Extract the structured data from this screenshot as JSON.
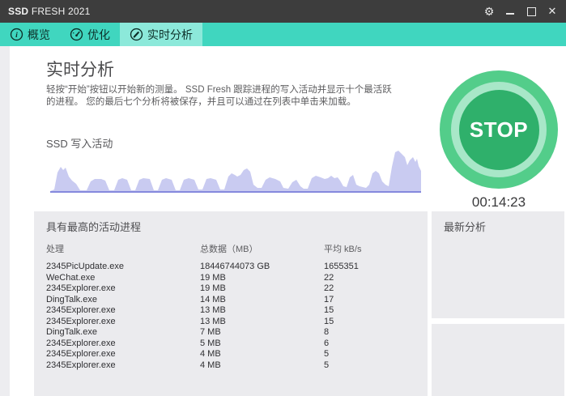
{
  "window": {
    "title_bold": "SSD",
    "title_rest": " FRESH 2021"
  },
  "titlebar": {
    "gear_glyph": "⚙",
    "close_glyph": "✕"
  },
  "tabs": [
    {
      "id": "overview",
      "label": "概览",
      "icon": "info-circle-icon",
      "active": false
    },
    {
      "id": "optimize",
      "label": "优化",
      "icon": "gauge-icon",
      "active": false
    },
    {
      "id": "realtime",
      "label": "实时分析",
      "icon": "pencil-circle-icon",
      "active": true
    }
  ],
  "main": {
    "heading": "实时分析",
    "description_line1": "轻按“开始”按钮以开始新的测量。 SSD Fresh 跟踪进程的写入活动并显示十个最活跃",
    "description_line2": "的进程。 您的最后七个分析将被保存，并且可以通过在列表中单击来加载。",
    "chart_label": "SSD 写入活动",
    "stop_button_label": "STOP",
    "timer": "00:14:23"
  },
  "process_table": {
    "title": "具有最高的活动进程",
    "columns": [
      "处理",
      "总数据（MB）",
      "平均 kB/s"
    ],
    "rows": [
      [
        "2345PicUpdate.exe",
        "18446744073 GB",
        "1655351"
      ],
      [
        "WeChat.exe",
        "19 MB",
        "22"
      ],
      [
        "2345Explorer.exe",
        "19 MB",
        "22"
      ],
      [
        "DingTalk.exe",
        "14 MB",
        "17"
      ],
      [
        "2345Explorer.exe",
        "13 MB",
        "15"
      ],
      [
        "2345Explorer.exe",
        "13 MB",
        "15"
      ],
      [
        "DingTalk.exe",
        "7 MB",
        "8"
      ],
      [
        "2345Explorer.exe",
        "5 MB",
        "6"
      ],
      [
        "2345Explorer.exe",
        "4 MB",
        "5"
      ],
      [
        "2345Explorer.exe",
        "4 MB",
        "5"
      ]
    ]
  },
  "latest_analyses": {
    "title": "最新分析"
  },
  "colors": {
    "titlebar": "#3d3d3d",
    "accent_teal": "#40d6bf",
    "active_tab": "#8ce9da",
    "panel_gray": "#ebebee",
    "chart_fill": "#c9cbf1",
    "chart_baseline": "#8589dd",
    "stop_outer_green": "#53cd8a",
    "stop_ring_light": "#a8e7c8",
    "stop_inner_green": "#2fb06b"
  },
  "chart_data": {
    "type": "area",
    "title": "SSD 写入活动",
    "series_name": "SSD write activity",
    "xlabel": "",
    "ylabel": "",
    "axes_visible": false,
    "note": "unlabeled sparkline area chart; points are [x_px 0-458, height_px 0-53 above baseline]",
    "points": [
      [
        0,
        1
      ],
      [
        5,
        3
      ],
      [
        9,
        24
      ],
      [
        13,
        31
      ],
      [
        16,
        27
      ],
      [
        19,
        30
      ],
      [
        23,
        19
      ],
      [
        27,
        14
      ],
      [
        32,
        10
      ],
      [
        37,
        2
      ],
      [
        45,
        2
      ],
      [
        50,
        13
      ],
      [
        55,
        16
      ],
      [
        63,
        16
      ],
      [
        68,
        14
      ],
      [
        73,
        2
      ],
      [
        79,
        2
      ],
      [
        84,
        15
      ],
      [
        89,
        17
      ],
      [
        95,
        15
      ],
      [
        100,
        2
      ],
      [
        105,
        2
      ],
      [
        110,
        15
      ],
      [
        115,
        17
      ],
      [
        123,
        16
      ],
      [
        128,
        2
      ],
      [
        133,
        2
      ],
      [
        138,
        15
      ],
      [
        143,
        17
      ],
      [
        150,
        15
      ],
      [
        155,
        2
      ],
      [
        160,
        2
      ],
      [
        165,
        15
      ],
      [
        171,
        17
      ],
      [
        178,
        15
      ],
      [
        183,
        3
      ],
      [
        188,
        3
      ],
      [
        193,
        16
      ],
      [
        198,
        17
      ],
      [
        205,
        15
      ],
      [
        210,
        3
      ],
      [
        215,
        3
      ],
      [
        220,
        19
      ],
      [
        224,
        23
      ],
      [
        228,
        21
      ],
      [
        231,
        19
      ],
      [
        235,
        21
      ],
      [
        239,
        27
      ],
      [
        243,
        29
      ],
      [
        247,
        25
      ],
      [
        251,
        9
      ],
      [
        256,
        5
      ],
      [
        261,
        5
      ],
      [
        266,
        15
      ],
      [
        271,
        18
      ],
      [
        278,
        16
      ],
      [
        284,
        13
      ],
      [
        288,
        5
      ],
      [
        294,
        4
      ],
      [
        299,
        12
      ],
      [
        304,
        15
      ],
      [
        309,
        7
      ],
      [
        313,
        4
      ],
      [
        318,
        4
      ],
      [
        323,
        17
      ],
      [
        328,
        20
      ],
      [
        334,
        18
      ],
      [
        339,
        16
      ],
      [
        343,
        17
      ],
      [
        347,
        20
      ],
      [
        351,
        17
      ],
      [
        355,
        18
      ],
      [
        358,
        14
      ],
      [
        362,
        7
      ],
      [
        366,
        6
      ],
      [
        370,
        18
      ],
      [
        374,
        21
      ],
      [
        378,
        9
      ],
      [
        382,
        7
      ],
      [
        386,
        6
      ],
      [
        390,
        5
      ],
      [
        394,
        9
      ],
      [
        398,
        23
      ],
      [
        402,
        26
      ],
      [
        406,
        23
      ],
      [
        410,
        13
      ],
      [
        414,
        9
      ],
      [
        418,
        7
      ],
      [
        422,
        31
      ],
      [
        426,
        49
      ],
      [
        430,
        51
      ],
      [
        434,
        47
      ],
      [
        438,
        43
      ],
      [
        441,
        33
      ],
      [
        444,
        39
      ],
      [
        448,
        43
      ],
      [
        451,
        37
      ],
      [
        453,
        41
      ],
      [
        455,
        32
      ],
      [
        458,
        26
      ]
    ]
  }
}
